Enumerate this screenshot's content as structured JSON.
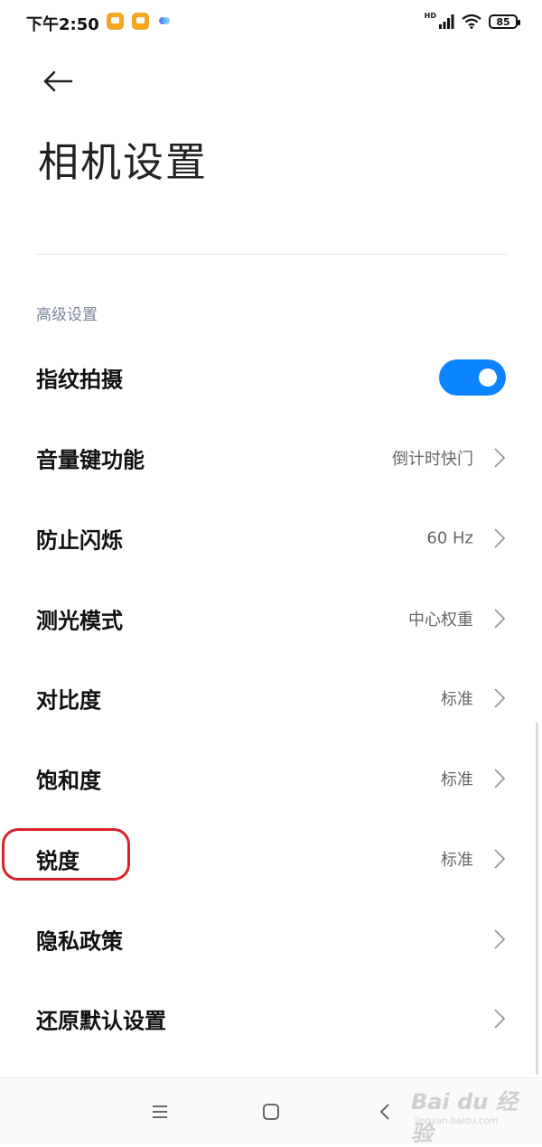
{
  "status_bar": {
    "time": "下午2:50",
    "network_label": "HD",
    "battery_level": "85"
  },
  "header": {
    "title": "相机设置"
  },
  "section": {
    "title": "高级设置"
  },
  "settings": [
    {
      "label": "指纹拍摄",
      "type": "toggle",
      "enabled": true
    },
    {
      "label": "音量键功能",
      "value": "倒计时快门"
    },
    {
      "label": "防止闪烁",
      "value": "60 Hz"
    },
    {
      "label": "测光模式",
      "value": "中心权重"
    },
    {
      "label": "对比度",
      "value": "标准"
    },
    {
      "label": "饱和度",
      "value": "标准"
    },
    {
      "label": "锐度",
      "value": "标准"
    },
    {
      "label": "隐私政策",
      "value": ""
    },
    {
      "label": "还原默认设置",
      "value": ""
    }
  ],
  "watermark": {
    "brand": "Bai du 经验",
    "url": "jingyan.baidu.com"
  },
  "colors": {
    "accent": "#0d84ff",
    "annotation": "#d8232a",
    "section_header": "#7a8598"
  }
}
